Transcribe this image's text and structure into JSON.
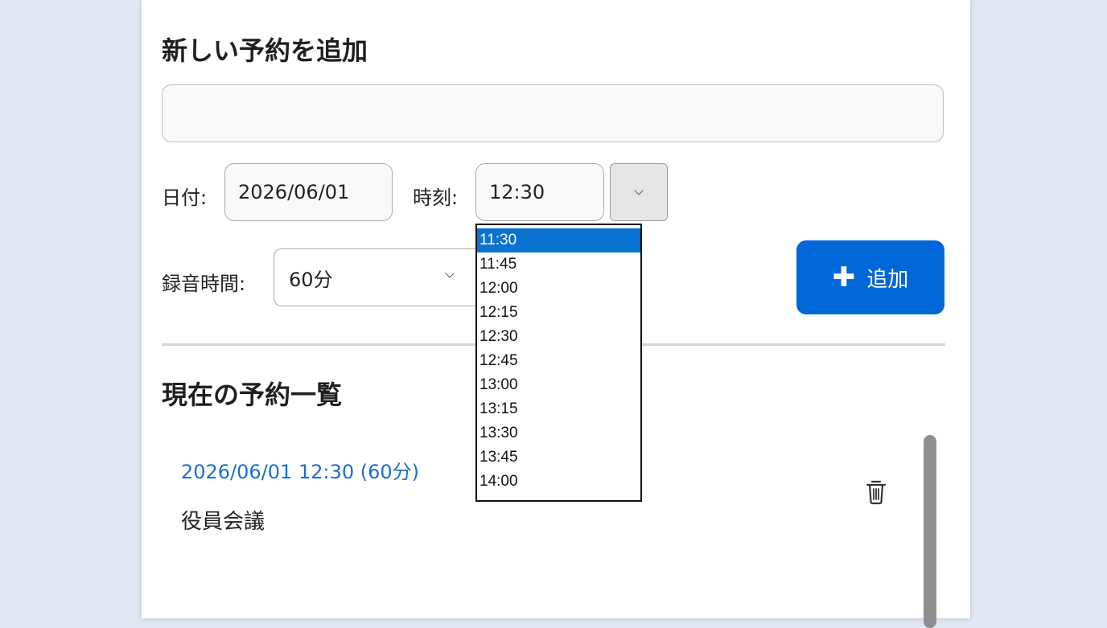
{
  "form": {
    "title": "新しい予約を追加",
    "name_value": "",
    "date_label": "日付:",
    "date_value": "2026/06/01",
    "time_label": "時刻:",
    "time_value": "12:30",
    "duration_label": "録音時間:",
    "duration_value": "60分",
    "add_button_label": "追加",
    "time_options": [
      "11:30",
      "11:45",
      "12:00",
      "12:15",
      "12:30",
      "12:45",
      "13:00",
      "13:15",
      "13:30",
      "13:45",
      "14:00"
    ],
    "highlighted_option": "11:30"
  },
  "reservations": {
    "title": "現在の予約一覧",
    "items": [
      {
        "when": "2026/06/01 12:30 (60分)",
        "name": "役員会議"
      }
    ]
  },
  "colors": {
    "accent": "#0067d9",
    "link": "#1a6fd1",
    "background": "#e1e7f3"
  },
  "icons": {
    "add": "plus-icon",
    "delete": "trash-icon",
    "dropdown": "chevron-down-icon"
  }
}
